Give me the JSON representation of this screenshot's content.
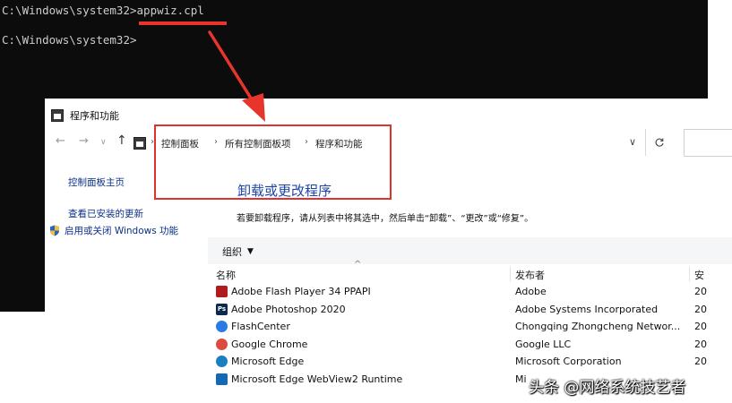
{
  "console": {
    "line1_prompt": "C:\\Windows\\system32>",
    "line1_command": "appwiz.cpl",
    "line2_prompt": "C:\\Windows\\system32>",
    "colors": {
      "background": "#0c0c0c",
      "text": "#cccccc",
      "underline": "#e8352c"
    }
  },
  "window": {
    "title": "程序和功能",
    "title_icon": "control-panel-icon"
  },
  "address_bar": {
    "nav_icons": [
      "back-arrow-icon",
      "forward-arrow-icon",
      "recent-chevron-icon",
      "up-arrow-icon"
    ],
    "breadcrumbs": [
      "控制面板",
      "所有控制面板项",
      "程序和功能"
    ],
    "refresh_icon": "refresh-icon",
    "dropdown_icon": "chevron-down-icon"
  },
  "sidebar": {
    "home": "控制面板主页",
    "view_updates": "查看已安装的更新",
    "windows_features": "启用或关闭 Windows 功能",
    "features_icon": "shield-icon"
  },
  "main": {
    "heading": "卸载或更改程序",
    "description": "若要卸载程序，请从列表中将其选中，然后单击“卸载”、“更改”或“修复”。",
    "organize_label": "组织",
    "columns": {
      "name": "名称",
      "publisher": "发布者",
      "installed": "安"
    },
    "rows": [
      {
        "name": "Adobe Flash Player 34 PPAPI",
        "publisher": "Adobe",
        "date": "20",
        "icon": "flash-player-icon",
        "icon_color": "#b01c1c"
      },
      {
        "name": "Adobe Photoshop 2020",
        "publisher": "Adobe Systems Incorporated",
        "date": "20",
        "icon": "photoshop-icon",
        "icon_color": "#0b2a4e",
        "icon_text": "Ps"
      },
      {
        "name": "FlashCenter",
        "publisher": "Chongqing Zhongcheng Networ...",
        "date": "20",
        "icon": "flashcenter-icon",
        "icon_color": "#2a7be4"
      },
      {
        "name": "Google Chrome",
        "publisher": "Google LLC",
        "date": "20",
        "icon": "chrome-icon",
        "icon_color": "#dd4b3e"
      },
      {
        "name": "Microsoft Edge",
        "publisher": "Microsoft Corporation",
        "date": "20",
        "icon": "edge-icon",
        "icon_color": "#1a7fc1"
      },
      {
        "name": "Microsoft Edge WebView2 Runtime",
        "publisher": "Mi",
        "date": "",
        "icon": "webview2-icon",
        "icon_color": "#1668b6"
      }
    ]
  },
  "annotation": {
    "highlight_color": "#e0322c"
  },
  "watermark": "头条 @网络系统技艺者"
}
